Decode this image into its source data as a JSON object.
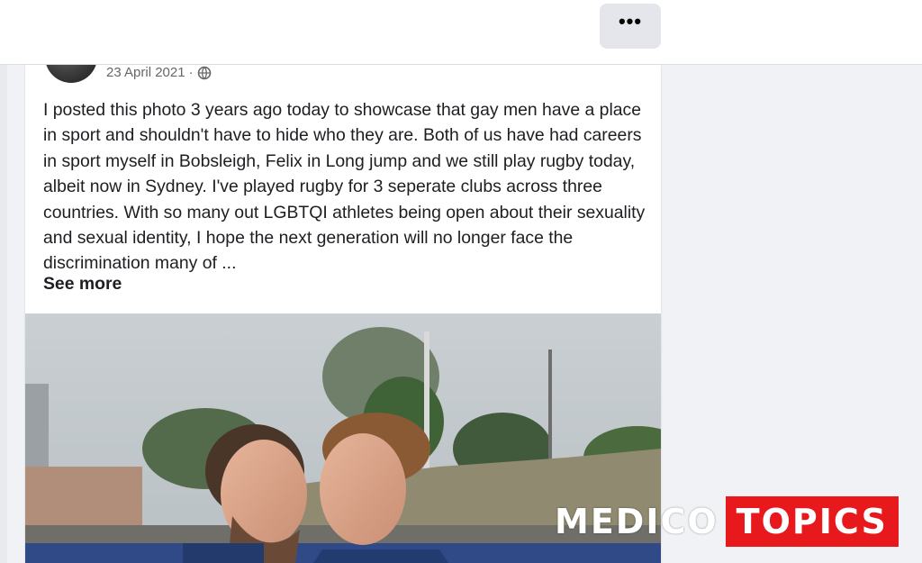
{
  "topbar": {
    "more_label": "•••"
  },
  "post": {
    "date": "23 April 2021",
    "separator": "·",
    "privacy_icon": "globe-icon",
    "text": "I posted this photo 3 years ago today to showcase that gay men have a place in sport and shouldn't have to hide who they are. Both of us have had careers in sport myself in Bobsleigh, Felix in Long jump and we still play rugby today, albeit now in Sydney. I've played rugby for 3 seperate clubs across three countries. With so many out LGBTQI athletes being open about their sexuality and sexual identity, I hope the next generation will no longer face the discrimination many of ...",
    "see_more": "See more"
  },
  "watermark": {
    "left": "MEDICO",
    "right": "TOPICS",
    "accent_color": "#e8191c"
  }
}
